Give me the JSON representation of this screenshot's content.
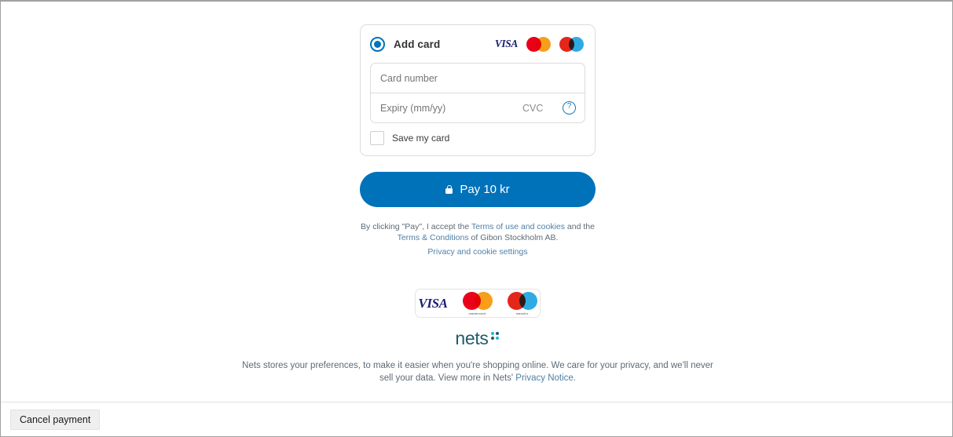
{
  "card_form": {
    "option_label": "Add card",
    "radio_selected": true,
    "accepted_brands": [
      "visa",
      "mastercard",
      "maestro"
    ],
    "fields": {
      "card_number": {
        "value": "",
        "placeholder": "Card number"
      },
      "expiry": {
        "value": "",
        "placeholder": "Expiry (mm/yy)"
      },
      "cvc": {
        "value": "",
        "placeholder": "CVC"
      }
    },
    "cvc_help_icon": "question-circle-icon",
    "save_card": {
      "label": "Save my card",
      "checked": false
    }
  },
  "pay_button": {
    "label": "Pay 10 kr",
    "amount": "10",
    "currency": "kr",
    "icon": "lock-icon",
    "color": "#0072ba"
  },
  "legal": {
    "prefix": "By clicking \"Pay\", I accept the ",
    "terms_of_use_link": "Terms of use and cookies",
    "middle": " and the ",
    "terms_conditions_link": "Terms & Conditions",
    "suffix": " of Gibon Stockholm AB.",
    "merchant": "Gibon Stockholm AB",
    "privacy_settings_link": "Privacy and cookie settings"
  },
  "brand_strip": {
    "visa_label": "VISA",
    "mastercard_word": "mastercard",
    "maestro_word": "maestro"
  },
  "provider": {
    "name": "nets",
    "footer_text_before": "Nets stores your preferences, to make it easier when you're shopping online. We care for your privacy, and we'll never sell your data. View more in Nets' ",
    "footer_link": "Privacy Notice.",
    "logo_colors": {
      "dark": "#1d5c6b",
      "light": "#29b6e0"
    }
  },
  "bottom_bar": {
    "cancel_label": "Cancel payment"
  }
}
